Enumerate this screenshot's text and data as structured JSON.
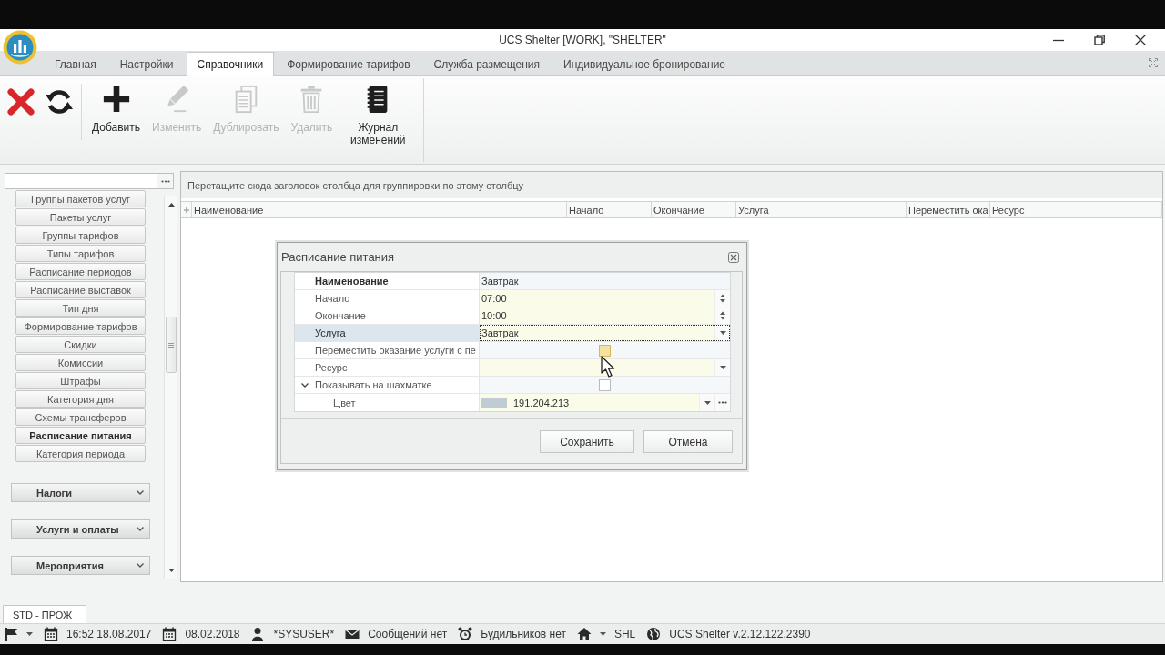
{
  "window": {
    "title": "UCS Shelter [WORK], \"SHELTER\""
  },
  "tabs": [
    {
      "label": "Главная",
      "selected": false
    },
    {
      "label": "Настройки",
      "selected": false
    },
    {
      "label": "Справочники",
      "selected": true
    },
    {
      "label": "Формирование тарифов",
      "selected": false
    },
    {
      "label": "Служба размещения",
      "selected": false
    },
    {
      "label": "Индивидуальное бронирование",
      "selected": false
    }
  ],
  "toolbar": {
    "buttons": [
      {
        "kind": "cancel",
        "disabled": false
      },
      {
        "kind": "refresh",
        "disabled": false
      },
      {
        "kind": "add",
        "label": "Добавить",
        "disabled": false
      },
      {
        "kind": "edit",
        "label": "Изменить",
        "disabled": true
      },
      {
        "kind": "duplicate",
        "label": "Дублировать",
        "disabled": true
      },
      {
        "kind": "delete",
        "label": "Удалить",
        "disabled": true
      },
      {
        "kind": "log",
        "label": "Журнал изменений",
        "disabled": false
      }
    ]
  },
  "sidebar": {
    "items": [
      {
        "label": "Группы пакетов услуг",
        "selected": false
      },
      {
        "label": "Пакеты услуг",
        "selected": false
      },
      {
        "label": "Группы тарифов",
        "selected": false
      },
      {
        "label": "Типы тарифов",
        "selected": false
      },
      {
        "label": "Расписание периодов",
        "selected": false
      },
      {
        "label": "Расписание выставок",
        "selected": false
      },
      {
        "label": "Тип дня",
        "selected": false
      },
      {
        "label": "Формирование тарифов",
        "selected": false
      },
      {
        "label": "Скидки",
        "selected": false
      },
      {
        "label": "Комиссии",
        "selected": false
      },
      {
        "label": "Штрафы",
        "selected": false
      },
      {
        "label": "Категория дня",
        "selected": false
      },
      {
        "label": "Схемы трансферов",
        "selected": false
      },
      {
        "label": "Расписание питания",
        "selected": true
      },
      {
        "label": "Категория периода",
        "selected": false
      }
    ],
    "groups": [
      {
        "label": "Налоги",
        "expanded": false
      },
      {
        "label": "Услуги и оплаты",
        "expanded": false
      },
      {
        "label": "Мероприятия",
        "expanded": false
      }
    ]
  },
  "grid": {
    "group_panel_hint": "Перетащите сюда заголовок столбца для группировки по этому столбцу",
    "columns": [
      "Наименование",
      "Начало",
      "Окончание",
      "Услуга",
      "Переместить ока",
      "Ресурс"
    ]
  },
  "dialog": {
    "title": "Расписание питания",
    "rows": [
      {
        "label": "Наименование",
        "kind": "text",
        "value": "Завтрак",
        "required": true,
        "selected": false
      },
      {
        "label": "Начало",
        "kind": "spin",
        "value": "07:00",
        "required": false,
        "selected": false
      },
      {
        "label": "Окончание",
        "kind": "spin",
        "value": "10:00",
        "required": false,
        "selected": false
      },
      {
        "label": "Услуга",
        "kind": "dropdown",
        "value": "Завтрак",
        "required": false,
        "selected": true
      },
      {
        "label": "Переместить оказание услуги с пе",
        "kind": "checkbox",
        "checked": false,
        "hovered": true,
        "required": false,
        "selected": false
      },
      {
        "label": "Ресурс",
        "kind": "dropdown",
        "required": false,
        "selected": false
      },
      {
        "label": "Показывать на шахматке",
        "kind": "checkbox",
        "checked": false,
        "hovered": false,
        "required": false,
        "selected": false,
        "expanded": true,
        "children": [
          {
            "label": "Цвет",
            "kind": "color",
            "value": "191.204.213",
            "color": "#bfccd5",
            "required": false,
            "selected": false
          }
        ]
      }
    ],
    "buttons": [
      "Сохранить",
      "Отмена"
    ]
  },
  "document_tabs": [
    {
      "label": "STD - ПРОЖ",
      "selected": true
    }
  ],
  "status_bar": {
    "items": [
      {
        "kind": "flag",
        "dropdown": true
      },
      {
        "kind": "calendar",
        "text": "16:52 18.08.2017",
        "dropdown": false
      },
      {
        "kind": "calendar",
        "text": "08.02.2018",
        "dropdown": false
      },
      {
        "kind": "user",
        "text": "*SYSUSER*",
        "dropdown": false
      },
      {
        "kind": "mail",
        "text": "Сообщений нет",
        "dropdown": false
      },
      {
        "kind": "alarm",
        "text": "Будильников нет",
        "dropdown": false
      },
      {
        "kind": "home",
        "text": "SHL",
        "dropdown": true
      },
      {
        "kind": "globe",
        "text": "UCS Shelter v.2.12.122.2390",
        "dropdown": false
      }
    ]
  }
}
